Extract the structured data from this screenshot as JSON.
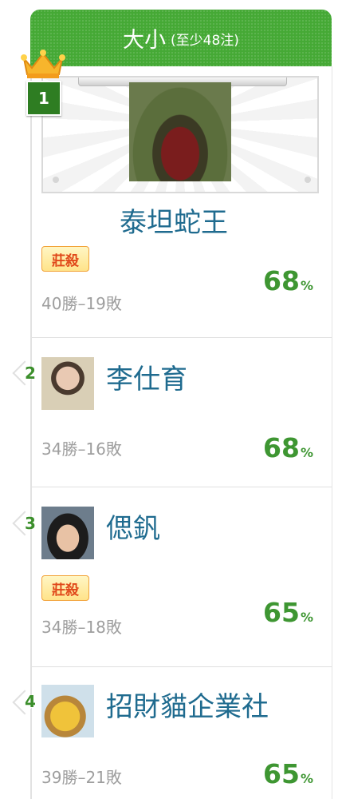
{
  "header": {
    "title": "大小",
    "subtitle": "(至少48注)"
  },
  "leaders": [
    {
      "rank": "1",
      "name": "泰坦蛇王",
      "tag": "莊殺",
      "record": "40勝–19敗",
      "pct": "68",
      "unit": "%"
    },
    {
      "rank": "2",
      "name": "李仕育",
      "tag": "",
      "record": "34勝–16敗",
      "pct": "68",
      "unit": "%"
    },
    {
      "rank": "3",
      "name": "偲釩",
      "tag": "莊殺",
      "record": "34勝–18敗",
      "pct": "65",
      "unit": "%"
    },
    {
      "rank": "4",
      "name": "招財貓企業社",
      "tag": "",
      "record": "39勝–21敗",
      "pct": "65",
      "unit": "%"
    }
  ],
  "colors": {
    "header": "#45a935",
    "name": "#1f6b8f",
    "pct": "#3e9632",
    "rank": "#3c8f2c"
  },
  "icons": {
    "crown": "crown-icon"
  }
}
